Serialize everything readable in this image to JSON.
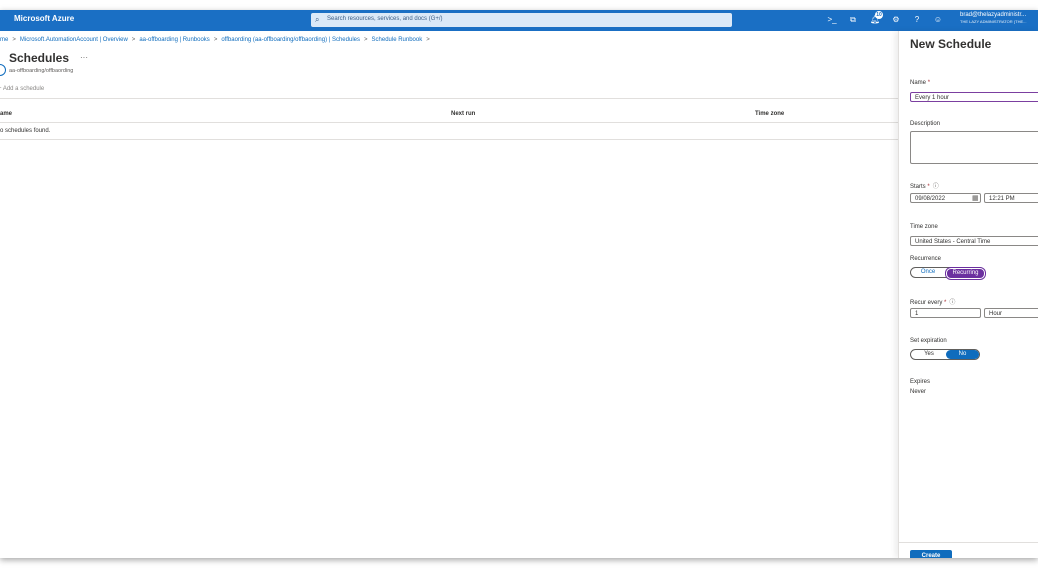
{
  "topbar": {
    "brand": "Microsoft Azure",
    "search_placeholder": "Search resources, services, and docs (G+/)",
    "notification_count": "10",
    "user_email": "brad@thelazyadministr...",
    "user_org": "THE LAZY ADMINISTRATOR (THE...",
    "icons": [
      "cloud-shell-icon",
      "directory-filter-icon",
      "notifications-icon",
      "settings-icon",
      "help-icon",
      "feedback-icon"
    ]
  },
  "breadcrumb": [
    "me",
    "Microsoft.AutomationAccount | Overview",
    "aa-offboarding | Runbooks",
    "offbaording (aa-offboarding/offbaording) | Schedules",
    "Schedule Runbook"
  ],
  "page": {
    "title": "Schedules",
    "subtitle": "aa-offboarding/offbaording",
    "add_schedule": "Add a schedule"
  },
  "table": {
    "headers": [
      "ame",
      "Next run",
      "Time zone"
    ],
    "empty_text": "o schedules found."
  },
  "panel": {
    "title": "New Schedule",
    "name_label": "Name",
    "name_value": "Every 1 hour",
    "description_label": "Description",
    "starts_label": "Starts",
    "start_date": "09/08/2022",
    "start_time": "12:21 PM",
    "timezone_label": "Time zone",
    "timezone_value": "United States - Central Time",
    "recurrence_label": "Recurrence",
    "recurrence_options": [
      "Once",
      "Recurring"
    ],
    "recurrence_selected": "Recurring",
    "recur_every_label": "Recur every",
    "recur_every_value": "1",
    "recur_every_unit": "Hour",
    "expiration_label": "Set expiration",
    "expiration_options": [
      "Yes",
      "No"
    ],
    "expiration_selected": "No",
    "expires_label": "Expires",
    "expires_value": "Never",
    "create_button": "Create"
  },
  "colors": {
    "topbar": "#1a6fc4",
    "accent": "#0f6cbd",
    "recurrence_selected": "#6b2f9f"
  }
}
